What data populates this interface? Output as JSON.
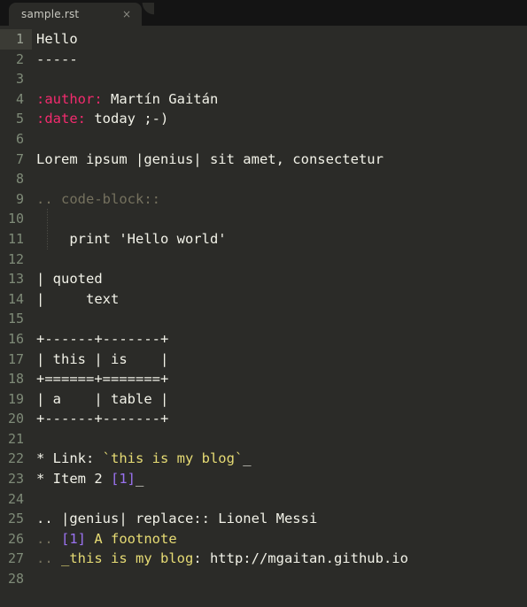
{
  "window": {
    "background": "#2b2b28",
    "tabbar_background": "#141414"
  },
  "tab": {
    "label": "sample.rst",
    "close_glyph": "×"
  },
  "editor": {
    "current_line": 1,
    "total_lines": 28,
    "colors": {
      "text": "#f2f2e8",
      "gutter": "#7f8b78",
      "field": "#f32b6e",
      "comment": "#75715e",
      "string": "#e6db74",
      "number": "#9a72f0",
      "current_line_gutter_bg": "#3b3b35"
    },
    "lines": [
      {
        "n": "1",
        "tokens": [
          {
            "t": "Hello",
            "c": "plain"
          }
        ]
      },
      {
        "n": "2",
        "tokens": [
          {
            "t": "-----",
            "c": "plain"
          }
        ]
      },
      {
        "n": "3",
        "tokens": []
      },
      {
        "n": "4",
        "tokens": [
          {
            "t": ":author:",
            "c": "field"
          },
          {
            "t": " Martín Gaitán",
            "c": "plain"
          }
        ]
      },
      {
        "n": "5",
        "tokens": [
          {
            "t": ":date:",
            "c": "field"
          },
          {
            "t": " today ;-)",
            "c": "plain"
          }
        ]
      },
      {
        "n": "6",
        "tokens": []
      },
      {
        "n": "7",
        "tokens": [
          {
            "t": "Lorem ipsum |genius| sit amet, consectetur",
            "c": "plain"
          }
        ]
      },
      {
        "n": "8",
        "tokens": []
      },
      {
        "n": "9",
        "tokens": [
          {
            "t": ".. code-block::",
            "c": "comment"
          }
        ]
      },
      {
        "n": "10",
        "tokens": []
      },
      {
        "n": "11",
        "tokens": [
          {
            "t": "    print 'Hello world'",
            "c": "plain"
          }
        ]
      },
      {
        "n": "12",
        "tokens": []
      },
      {
        "n": "13",
        "tokens": [
          {
            "t": "| quoted",
            "c": "plain"
          }
        ]
      },
      {
        "n": "14",
        "tokens": [
          {
            "t": "|     text",
            "c": "plain"
          }
        ]
      },
      {
        "n": "15",
        "tokens": []
      },
      {
        "n": "16",
        "tokens": [
          {
            "t": "+------+-------+",
            "c": "plain"
          }
        ]
      },
      {
        "n": "17",
        "tokens": [
          {
            "t": "| this | is    |",
            "c": "plain"
          }
        ]
      },
      {
        "n": "18",
        "tokens": [
          {
            "t": "+======+=======+",
            "c": "plain"
          }
        ]
      },
      {
        "n": "19",
        "tokens": [
          {
            "t": "| a    | table |",
            "c": "plain"
          }
        ]
      },
      {
        "n": "20",
        "tokens": [
          {
            "t": "+------+-------+",
            "c": "plain"
          }
        ]
      },
      {
        "n": "21",
        "tokens": []
      },
      {
        "n": "22",
        "tokens": [
          {
            "t": "* Link: ",
            "c": "plain"
          },
          {
            "t": "`this is my blog`",
            "c": "string"
          },
          {
            "t": "_",
            "c": "plain"
          }
        ]
      },
      {
        "n": "23",
        "tokens": [
          {
            "t": "* Item 2 ",
            "c": "plain"
          },
          {
            "t": "[1]",
            "c": "number"
          },
          {
            "t": "_",
            "c": "plain"
          }
        ]
      },
      {
        "n": "24",
        "tokens": []
      },
      {
        "n": "25",
        "tokens": [
          {
            "t": ".. |genius| replace:: Lionel Messi",
            "c": "plain"
          }
        ]
      },
      {
        "n": "26",
        "tokens": [
          {
            "t": ".. ",
            "c": "comment"
          },
          {
            "t": "[1]",
            "c": "number"
          },
          {
            "t": " A footnote",
            "c": "string"
          }
        ]
      },
      {
        "n": "27",
        "tokens": [
          {
            "t": ".. ",
            "c": "comment"
          },
          {
            "t": "_this is my blog",
            "c": "string"
          },
          {
            "t": ": http://mgaitan.github.io",
            "c": "plain"
          }
        ]
      },
      {
        "n": "28",
        "tokens": []
      }
    ]
  }
}
